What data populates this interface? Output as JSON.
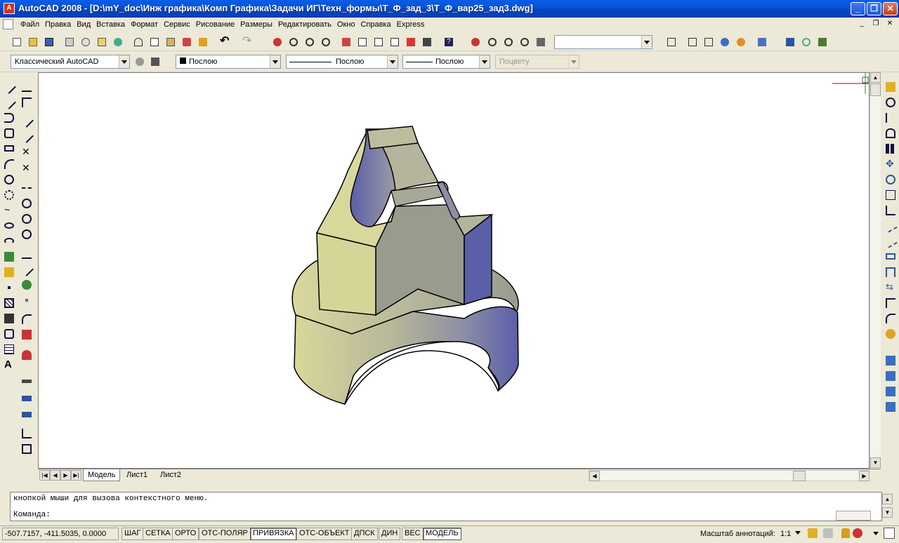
{
  "title": "AutoCAD 2008 - [D:\\mY_doc\\Инж графика\\Комп Графика\\Задачи ИГ\\Техн_формы\\Т_Ф_зад_3\\Т_Ф_вар25_зад3.dwg]",
  "menu": [
    "Файл",
    "Правка",
    "Вид",
    "Вставка",
    "Формат",
    "Сервис",
    "Рисование",
    "Размеры",
    "Редактировать",
    "Окно",
    "Справка",
    "Express"
  ],
  "workspace": "Классический AutoCAD",
  "layer_value": "Послою",
  "linetype_value": "Послою",
  "lineweight_value": "Послою",
  "plotstyle_value": "Поцвету",
  "tabs": [
    "Модель",
    "Лист1",
    "Лист2"
  ],
  "command_history": "кнопкой мыши для вызова контекстного меню.",
  "command_prompt": "Команда:",
  "coordinates": "-507.7157, -411.5035, 0.0000",
  "status_buttons": [
    "ШАГ",
    "СЕТКА",
    "ОРТО",
    "ОТС-ПОЛЯР",
    "ПРИВЯЗКА",
    "ОТС-ОБЪЕКТ",
    "ДПСК",
    "ДИН",
    "ВЕС",
    "МОДЕЛЬ"
  ],
  "annotation_scale_label": "Масштаб аннотаций:",
  "annotation_scale_value": "1:1",
  "colors": {
    "title_bar": "#0653d6",
    "model_face_yellow": "#d8d79a",
    "model_face_gray": "#9a9b8f",
    "model_face_blue": "#5a5fa8",
    "canvas": "#ffffff"
  }
}
